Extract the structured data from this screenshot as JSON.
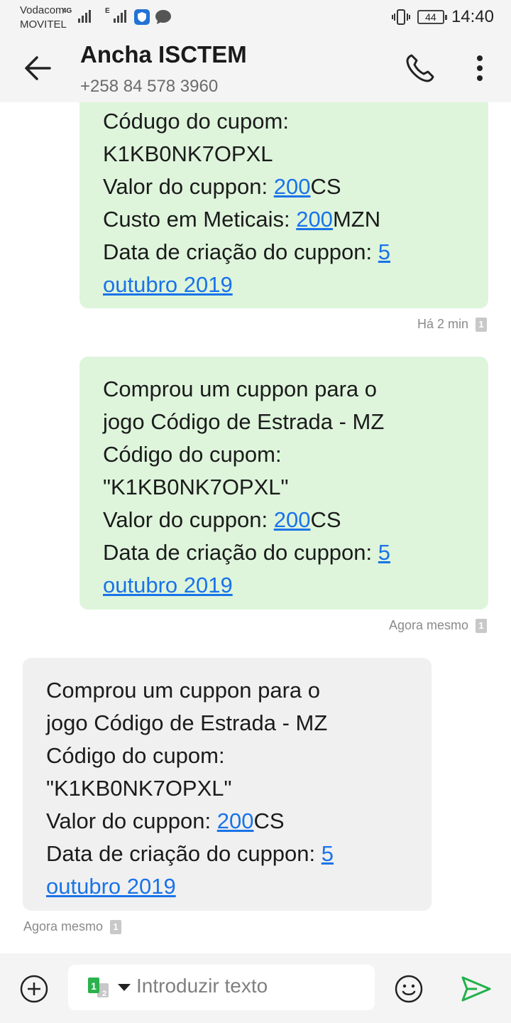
{
  "status": {
    "carrier1": "Vodacom",
    "carrier2": "MOVITEL",
    "net1": "4G",
    "net2": "E",
    "battery": "44",
    "time": "14:40"
  },
  "header": {
    "contact_name": "Ancha ISCTEM",
    "phone": "+258 84 578 3960"
  },
  "messages": [
    {
      "direction": "outgoing",
      "lines": [
        [
          "Códugo do cupom:"
        ],
        [
          "K1KB0NK7OPXL"
        ],
        [
          "Valor do cuppon: ",
          {
            "link": "200"
          },
          "CS"
        ],
        [
          "Custo em Meticais: ",
          {
            "link": "200"
          },
          "MZN"
        ],
        [
          "Data de criação do cuppon: ",
          {
            "link": "5"
          }
        ],
        [
          {
            "link": "outubro 2019"
          }
        ]
      ],
      "time": "Há 2 min",
      "sim": "1"
    },
    {
      "direction": "outgoing",
      "lines": [
        [
          "Comprou um cuppon para o"
        ],
        [
          "jogo Código de Estrada - MZ"
        ],
        [
          "Código do cupom:"
        ],
        [
          "\"K1KB0NK7OPXL\""
        ],
        [
          "Valor do cuppon: ",
          {
            "link": "200"
          },
          "CS"
        ],
        [
          "Data de criação do cuppon: ",
          {
            "link": "5"
          }
        ],
        [
          {
            "link": "outubro 2019"
          }
        ]
      ],
      "time": "Agora mesmo",
      "sim": "1"
    },
    {
      "direction": "incoming",
      "lines": [
        [
          "Comprou um cuppon para o"
        ],
        [
          "jogo Código de Estrada - MZ"
        ],
        [
          "Código do cupom:"
        ],
        [
          "\"K1KB0NK7OPXL\""
        ],
        [
          "Valor do cuppon: ",
          {
            "link": "200"
          },
          "CS"
        ],
        [
          "Data de criação do cuppon: ",
          {
            "link": "5"
          }
        ],
        [
          {
            "link": "outubro 2019"
          }
        ]
      ],
      "time": "Agora mesmo",
      "sim": "1"
    }
  ],
  "composer": {
    "placeholder": "Introduzir texto",
    "sim_selected": "1",
    "sim_other": "2"
  },
  "colors": {
    "outgoing_bubble": "#def5dc",
    "incoming_bubble": "#f0f0f0",
    "link": "#1a73e8",
    "send": "#21b14a",
    "sim1": "#2bb24c"
  },
  "icons": [
    "back-arrow-icon",
    "phone-icon",
    "more-vert-icon",
    "add-icon",
    "sim-select-icon",
    "emoji-icon",
    "send-icon",
    "vibrate-icon",
    "shield-app-icon",
    "chat-app-icon"
  ]
}
